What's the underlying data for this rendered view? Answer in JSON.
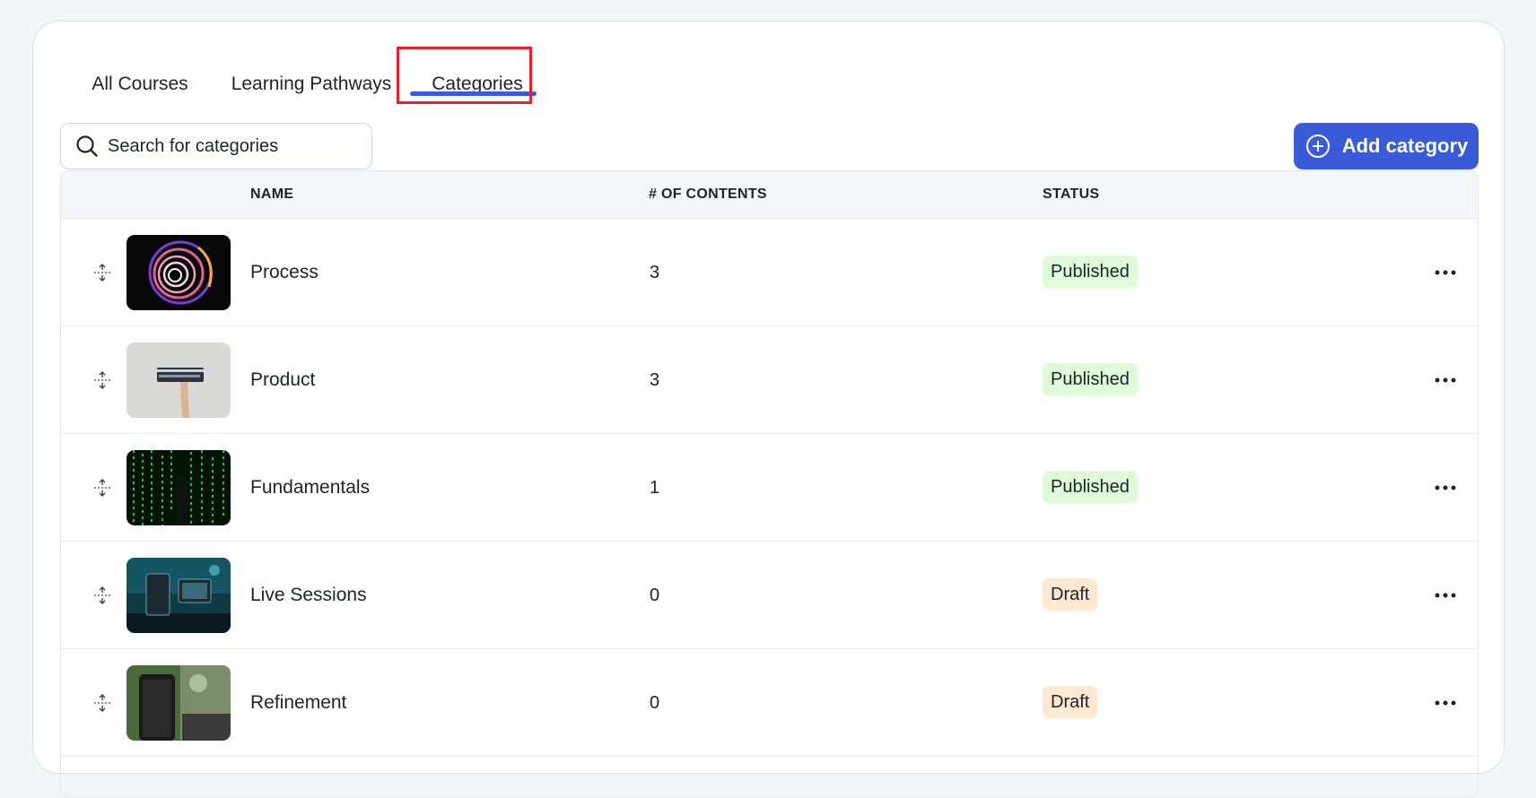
{
  "tabs": [
    {
      "label": "All Courses"
    },
    {
      "label": "Learning Pathways"
    },
    {
      "label": "Categories",
      "active": true
    }
  ],
  "search": {
    "placeholder": "Search for categories",
    "icon": "search-icon"
  },
  "add_button": {
    "label": "Add category",
    "icon": "plus-circle-icon"
  },
  "table": {
    "headers": {
      "name": "NAME",
      "count": "# OF CONTENTS",
      "status": "STATUS"
    },
    "rows": [
      {
        "name": "Process",
        "count": "3",
        "status": "Published"
      },
      {
        "name": "Product",
        "count": "3",
        "status": "Published"
      },
      {
        "name": "Fundamentals",
        "count": "1",
        "status": "Published"
      },
      {
        "name": "Live Sessions",
        "count": "0",
        "status": "Draft"
      },
      {
        "name": "Refinement",
        "count": "0",
        "status": "Draft"
      }
    ]
  },
  "colors": {
    "accent": "#3a5bd9",
    "highlight_box": "#e0242c",
    "published_bg": "#dcfbd6",
    "draft_bg": "#fde8d2"
  }
}
